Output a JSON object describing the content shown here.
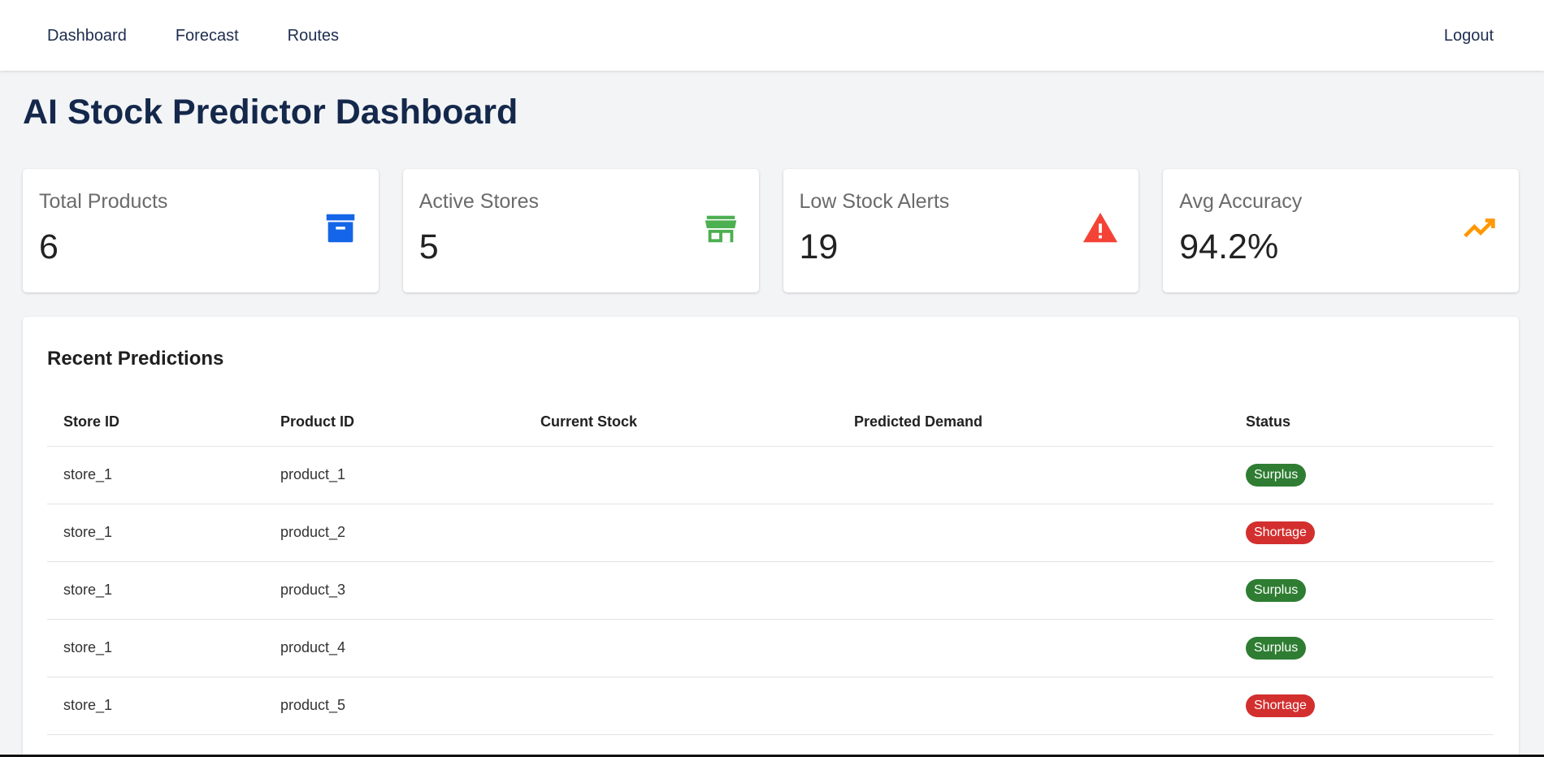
{
  "nav": {
    "links": [
      "Dashboard",
      "Forecast",
      "Routes"
    ],
    "logout": "Logout"
  },
  "page": {
    "title": "AI Stock Predictor Dashboard"
  },
  "cards": [
    {
      "label": "Total Products",
      "value": "6",
      "icon": "archive-box-icon",
      "color": "#1565e8"
    },
    {
      "label": "Active Stores",
      "value": "5",
      "icon": "store-icon",
      "color": "#4caf50"
    },
    {
      "label": "Low Stock Alerts",
      "value": "19",
      "icon": "warning-icon",
      "color": "#f44336"
    },
    {
      "label": "Avg Accuracy",
      "value": "94.2%",
      "icon": "trending-up-icon",
      "color": "#ff9800"
    }
  ],
  "predictions": {
    "title": "Recent Predictions",
    "columns": [
      "Store ID",
      "Product ID",
      "Current Stock",
      "Predicted Demand",
      "Status"
    ],
    "rows": [
      {
        "store": "store_1",
        "product": "product_1",
        "current": "",
        "predicted": "",
        "status": "Surplus"
      },
      {
        "store": "store_1",
        "product": "product_2",
        "current": "",
        "predicted": "",
        "status": "Shortage"
      },
      {
        "store": "store_1",
        "product": "product_3",
        "current": "",
        "predicted": "",
        "status": "Surplus"
      },
      {
        "store": "store_1",
        "product": "product_4",
        "current": "",
        "predicted": "",
        "status": "Surplus"
      },
      {
        "store": "store_1",
        "product": "product_5",
        "current": "",
        "predicted": "",
        "status": "Shortage"
      }
    ],
    "status_colors": {
      "Surplus": "#2e7d32",
      "Shortage": "#d32f2f"
    }
  }
}
